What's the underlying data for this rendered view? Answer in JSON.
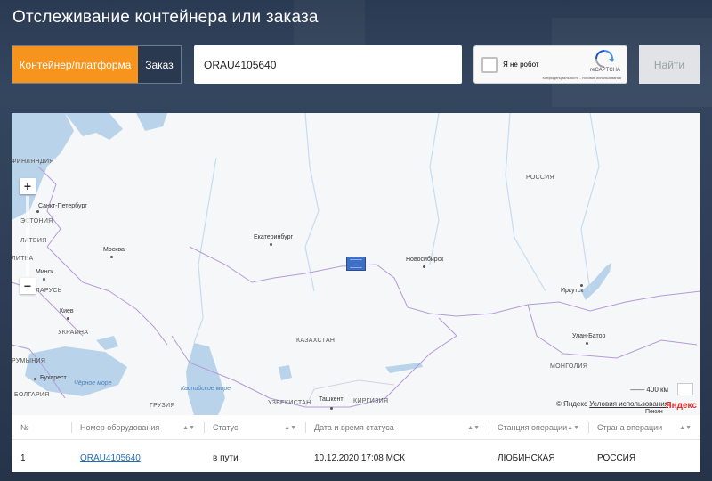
{
  "page": {
    "title": "Отслеживание контейнера или заказа"
  },
  "search": {
    "mode_container": "Контейнер/платформа",
    "mode_order": "Заказ",
    "value": "ORAU4105640",
    "find_label": "Найти"
  },
  "recaptcha": {
    "label": "Я не робот",
    "brand": "reCAPTCHA",
    "terms": "Конфиденциальность - Условия использования"
  },
  "map": {
    "labels": {
      "finland": "ФИНЛЯНДИЯ",
      "estonia": "ЭСТОНИЯ",
      "latvia": "ЛАТВИЯ",
      "lithuania": "ЛИТВА",
      "belarus": "ЕЛАРУСЬ",
      "ukraine": "УКРАИНА",
      "romania": "РУМЫНИЯ",
      "bulgaria": "БОЛГАРИЯ",
      "russia": "РОССИЯ",
      "kazakhstan": "КАЗАХСТАН",
      "uzbekistan": "УЗБЕКИСТАН",
      "kyrgyzstan": "КИРГИЗИЯ",
      "georgia": "ГРУЗИЯ",
      "mongolia": "МОНГОЛИЯ",
      "spb": "Санкт-Петербург",
      "moscow": "Москва",
      "minsk": "Минск",
      "kiev": "Киев",
      "bucharest": "Бухарест",
      "ekaterinburg": "Екатеринбург",
      "novosibirsk": "Новосибирск",
      "irkutsk": "Иркутск",
      "ulaanbaatar": "Улан-Батор",
      "tashkent": "Ташкент",
      "beijing": "Пекин",
      "black_sea": "Чёрное море",
      "caspian_sea": "Каспийское море"
    },
    "scale": "400 км",
    "copyright": "© Яндекс",
    "terms_link": "Условия использования",
    "logo": "Яндекс",
    "zoom_in": "+",
    "zoom_out": "−"
  },
  "table": {
    "headers": [
      "№",
      "Номер оборудования",
      "Статус",
      "Дата и время статуса",
      "Станция операции",
      "Страна операции"
    ],
    "row": {
      "num": "1",
      "equipment": "ORAU4105640",
      "status": "в пути",
      "datetime": "10.12.2020 17:08 МСК",
      "station": "ЛЮБИНСКАЯ",
      "country": "РОССИЯ"
    }
  },
  "colors": {
    "accent": "#f7941d",
    "link": "#1f6fbf",
    "marker": "#3f6fc4"
  }
}
